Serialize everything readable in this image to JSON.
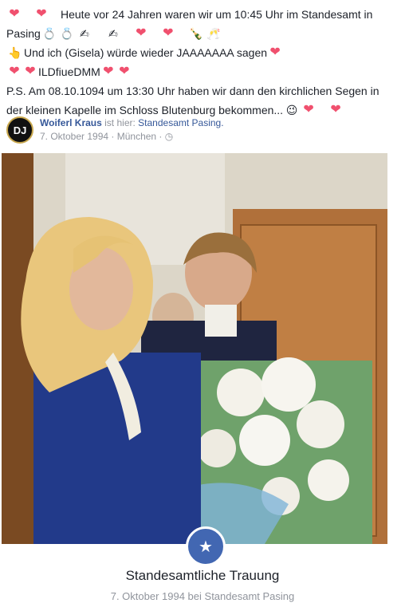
{
  "post": {
    "line1_text": "Heute vor 24 Jahren waren wir um 10:45 Uhr im Standesamt in",
    "line2_text": "Pasing",
    "line3_text": "Und ich (Gisela) würde wieder JAAAAAAA sagen",
    "line4_text": "ILDfiueDMM",
    "line5_text": "P.S. Am 08.10.1094 um 13:30 Uhr haben wir dann den kirchlichen Segen in",
    "line6_text": "der kleinen Kapelle im Schloss Blutenburg bekommen..."
  },
  "author": {
    "avatar_text": "DJ",
    "name": "Woiferl Kraus",
    "is_at": "ist hier:",
    "place": "Standesamt Pasing.",
    "date_location": "7. Oktober 1994 · München · "
  },
  "life_event": {
    "title": "Standesamtliche Trauung",
    "subtitle": "7. Oktober 1994 bei Standesamt Pasing"
  },
  "icons": {
    "heart": "heart-icon",
    "rings": "rings-icon",
    "writing_hand": "writing-hand-icon",
    "champagne": "champagne-icon",
    "pointing": "pointing-up-icon",
    "wink": "wink-icon",
    "clock": "clock-icon",
    "life_event": "star-icon"
  },
  "colors": {
    "heart": "#f0506e",
    "link": "#365899",
    "meta": "#90949c",
    "accent": "#4267b2"
  }
}
